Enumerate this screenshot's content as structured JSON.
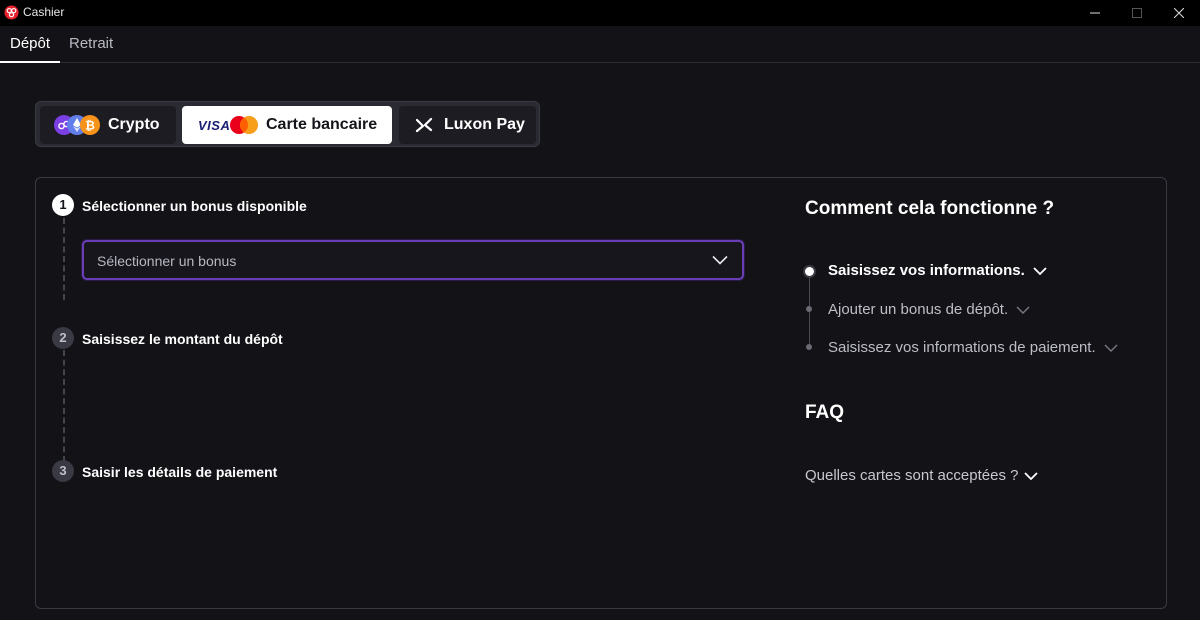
{
  "window": {
    "title": "Cashier",
    "accent_color": "#e6232e"
  },
  "tabs": [
    {
      "label": "Dépôt",
      "active": true
    },
    {
      "label": "Retrait",
      "active": false
    }
  ],
  "methods": {
    "crypto": {
      "label": "Crypto",
      "icons": [
        "polygon-icon",
        "ethereum-icon",
        "bitcoin-icon"
      ]
    },
    "card": {
      "label": "Carte bancaire",
      "visa_text": "VISA",
      "selected": true
    },
    "luxon": {
      "label": "Luxon Pay"
    }
  },
  "steps": [
    {
      "number": "1",
      "label": "Sélectionner un bonus disponible",
      "active": true
    },
    {
      "number": "2",
      "label": "Saisissez le montant du dépôt",
      "active": false
    },
    {
      "number": "3",
      "label": "Saisir les détails de paiement",
      "active": false
    }
  ],
  "bonus_select": {
    "placeholder": "Sélectionner un bonus",
    "border_color": "#6a3fb5"
  },
  "how_it_works": {
    "title": "Comment cela fonctionne ?",
    "items": [
      {
        "label": "Saisissez vos informations.",
        "active": true
      },
      {
        "label": "Ajouter un bonus de dépôt.",
        "active": false
      },
      {
        "label": "Saisissez vos informations de paiement.",
        "active": false
      }
    ]
  },
  "faq": {
    "title": "FAQ",
    "questions": [
      {
        "label": "Quelles cartes sont acceptées ?"
      }
    ]
  }
}
